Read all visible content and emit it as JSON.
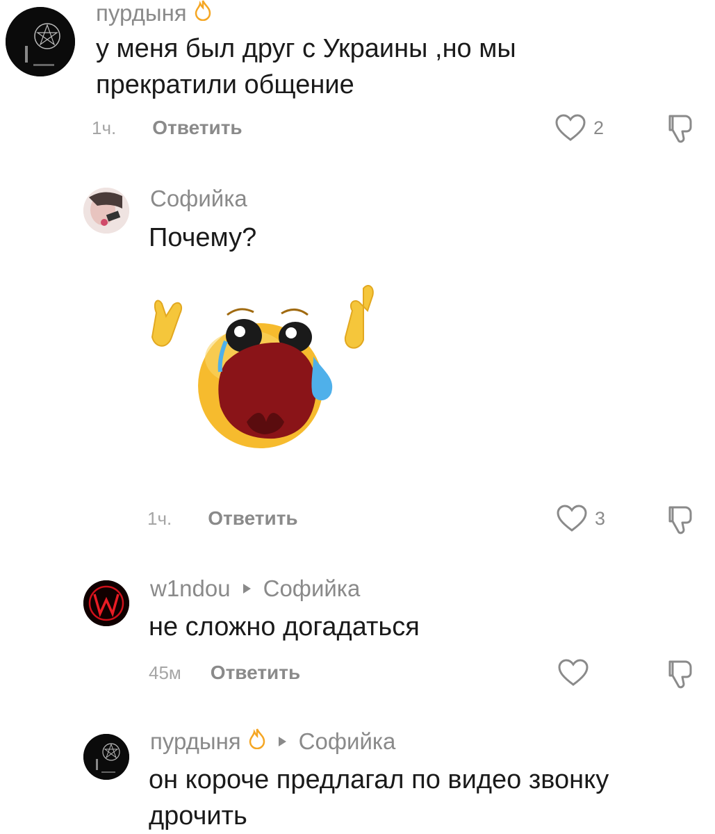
{
  "comments": [
    {
      "username": "пурдыня",
      "has_flame": true,
      "text_lines": [
        "у меня был друг с Украины ,но мы",
        "прекратили общение"
      ],
      "time": "1ч.",
      "reply_label": "Ответить",
      "likes": "2",
      "avatar_icon": "pentagram-icon"
    },
    {
      "username": "Софийка",
      "has_flame": false,
      "text_lines": [
        "Почему?"
      ],
      "sticker": "crying-emoji-sticker",
      "time": "1ч.",
      "reply_label": "Ответить",
      "likes": "3"
    },
    {
      "username": "w1ndou",
      "reply_to": "Софийка",
      "text_lines": [
        "не сложно догадаться"
      ],
      "time": "45м",
      "reply_label": "Ответить",
      "likes": "",
      "avatar_icon": "w-letter-icon"
    },
    {
      "username": "пурдыня",
      "has_flame": true,
      "reply_to": "Софийка",
      "text_lines": [
        "он короче предлагал по видео звонку",
        "дрочить"
      ],
      "avatar_icon": "pentagram-icon"
    }
  ],
  "colors": {
    "text": "#1a1a1a",
    "muted": "#8a8a8a",
    "time": "#a5a5a5",
    "flame": "#f5a623",
    "w_avatar": "#d0101a"
  }
}
